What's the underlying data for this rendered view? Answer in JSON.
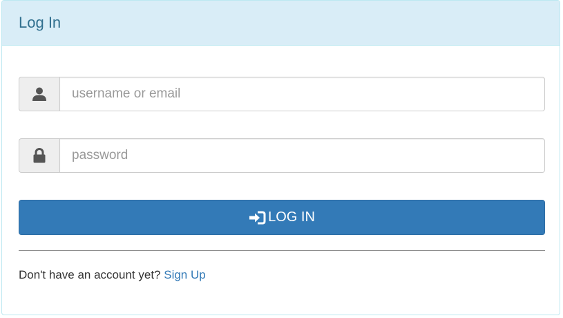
{
  "header": {
    "title": "Log In"
  },
  "form": {
    "username": {
      "placeholder": "username or email",
      "value": "",
      "icon": "user-icon"
    },
    "password": {
      "placeholder": "password",
      "value": "",
      "icon": "lock-icon"
    },
    "submit": {
      "label": "LOG IN",
      "icon": "log-in-icon"
    }
  },
  "footer": {
    "prompt": "Don't have an account yet?",
    "signup_label": "Sign Up"
  },
  "colors": {
    "heading_bg": "#d9edf7",
    "heading_text": "#31708f",
    "primary": "#337ab7"
  }
}
